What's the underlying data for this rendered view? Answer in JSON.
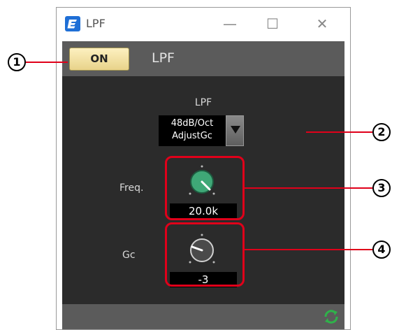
{
  "window": {
    "title": "LPF",
    "controls": {
      "minimize": "—",
      "maximize": "☐",
      "close": "✕"
    }
  },
  "header": {
    "on_button_label": "ON",
    "module_title": "LPF"
  },
  "filter_type": {
    "label": "LPF",
    "selected_line1": "48dB/Oct",
    "selected_line2": "AdjustGc"
  },
  "freq": {
    "label": "Freq.",
    "value": "20.0k",
    "knob_color": "#3fa877"
  },
  "gc": {
    "label": "Gc",
    "value": "-3",
    "knob_color": "#4a4a4a"
  },
  "callouts": {
    "c1": "1",
    "c2": "2",
    "c3": "3",
    "c4": "4"
  },
  "colors": {
    "accent_highlight": "#e0001a",
    "on_button": "#f4e3a3",
    "panel": "#2b2b2b",
    "bar": "#5b5b5b"
  },
  "icons": {
    "app": "editor-icon",
    "sync": "sync-icon"
  }
}
